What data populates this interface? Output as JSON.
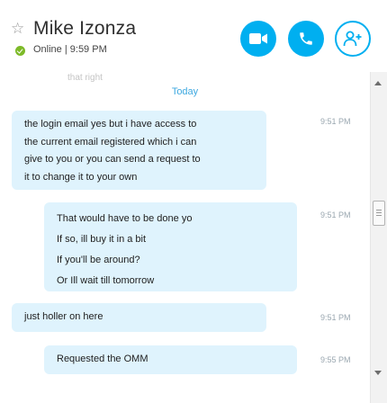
{
  "contact": {
    "name": "Mike Izonza",
    "status": "Online | 9:59 PM"
  },
  "header": {
    "buttons": [
      {
        "icon": "video-call-icon",
        "label": ""
      },
      {
        "icon": "phone-call-icon",
        "label": ""
      },
      {
        "icon": "add-people-icon",
        "label": ""
      }
    ]
  },
  "conversation": {
    "faded_previous": "that right",
    "day_separator": "Today",
    "messages": [
      {
        "direction": "incoming",
        "lines": [
          "the login email yes but i have access to",
          "the current email registered which i can",
          "give to you or you can send a request to",
          "it to change it to your own"
        ],
        "time": "9:51 PM"
      },
      {
        "direction": "outgoing",
        "lines": [
          "That would have to be done yo",
          "If so, ill buy it in a bit",
          "If you'll be around?",
          "Or Ill wait till tomorrow"
        ],
        "time": "9:51 PM"
      },
      {
        "direction": "incoming",
        "lines": [
          "just holler on here"
        ],
        "time": "9:51 PM"
      },
      {
        "direction": "outgoing",
        "lines": [
          "Requested the OMM"
        ],
        "time": "9:55 PM"
      }
    ]
  },
  "colors": {
    "accent": "#00aff0",
    "bubble": "#dff3fd",
    "online": "#7dba28",
    "day_separator": "#3fa9e0"
  }
}
